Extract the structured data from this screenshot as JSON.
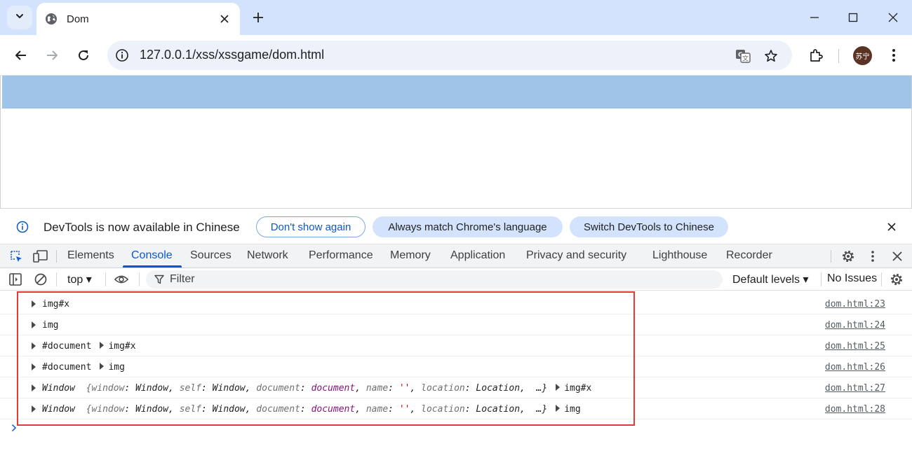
{
  "browser": {
    "tab_title": "Dom",
    "url": "127.0.0.1/xss/xssgame/dom.html",
    "profile_initials": "苏宁"
  },
  "infobar": {
    "message": "DevTools is now available in Chinese",
    "dont_show": "Don't show again",
    "always_match": "Always match Chrome's language",
    "switch": "Switch DevTools to Chinese"
  },
  "devtools": {
    "tabs": [
      "Elements",
      "Console",
      "Sources",
      "Network",
      "Performance",
      "Memory",
      "Application",
      "Privacy and security",
      "Lighthouse",
      "Recorder"
    ],
    "active_tab": "Console"
  },
  "console_toolbar": {
    "context": "top",
    "filter_placeholder": "Filter",
    "levels": "Default levels",
    "issues": "No Issues"
  },
  "console": {
    "rows": [
      {
        "text": "img#x",
        "src": "dom.html:23"
      },
      {
        "text": "img",
        "src": "dom.html:24"
      },
      {
        "prefix": "#document",
        "node": "img#x",
        "src": "dom.html:25"
      },
      {
        "prefix": "#document",
        "node": "img",
        "src": "dom.html:26"
      },
      {
        "prefix": "Window",
        "node": "img#x",
        "src": "dom.html:27"
      },
      {
        "prefix": "Window",
        "node": "img",
        "src": "dom.html:28"
      }
    ],
    "window_preview": {
      "open": "{",
      "k_window": "window",
      "v_window": "Window",
      "k_self": "self",
      "v_self": "Window",
      "k_document": "document",
      "v_document": "document",
      "k_name": "name",
      "v_name": "''",
      "k_location": "location",
      "v_location": "Location",
      "close": "…}"
    }
  },
  "colors": {
    "tabstrip": "#d3e3fd",
    "page_header": "#9fc4e7",
    "accent": "#0b57d0",
    "highlight_box": "#e53935"
  }
}
